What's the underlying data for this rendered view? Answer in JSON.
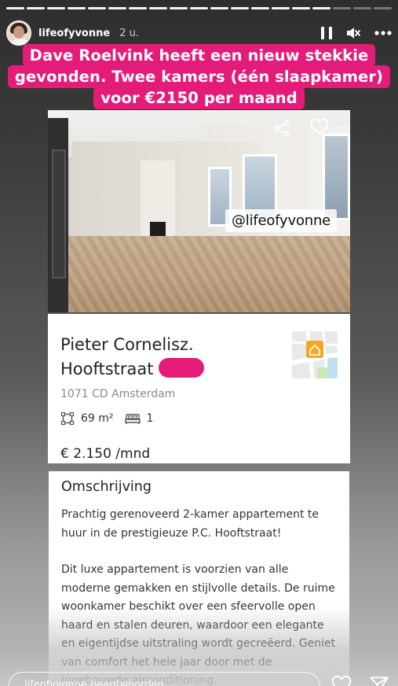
{
  "story": {
    "progress_total": 19,
    "progress_done": 16
  },
  "header": {
    "username": "lifeofyvonne",
    "time": "2 u."
  },
  "caption": {
    "lines": [
      "Dave Roelvink heeft een nieuw stekkie",
      "gevonden. Twee kamers (één slaapkamer)",
      "voor €2150 per maand"
    ],
    "background": "#e31c79"
  },
  "listing": {
    "photo_watermark": "@lifeofyvonne",
    "street_line1": "Pieter Cornelisz.",
    "street_line2": "Hooftstraat",
    "postal": "1071 CD Amsterdam",
    "area": "69 m²",
    "bedrooms": "1",
    "price": "€ 2.150 /mnd"
  },
  "description": {
    "title": "Omschrijving",
    "paragraph1": "Prachtig gerenoveerd 2-kamer appartement te huur in de prestigieuze P.C. Hooftstraat!",
    "paragraph2": "Dit luxe appartement is voorzien van alle moderne gemakken en stijlvolle details. De ruime woonkamer beschikt over een sfeervolle open haard en stalen deuren, waardoor een elegante en eigentijdse uitstraling wordt gecreëerd. Geniet van comfort het hele jaar door met de ingebouwde airconditioning."
  },
  "reply": {
    "placeholder": "lifeofyvonne beantwoorden..."
  },
  "icons": {
    "pause": "pause-icon",
    "mute": "mute-icon",
    "more": "more-icon",
    "share": "share-icon",
    "heart": "heart-icon",
    "send": "send-icon"
  }
}
